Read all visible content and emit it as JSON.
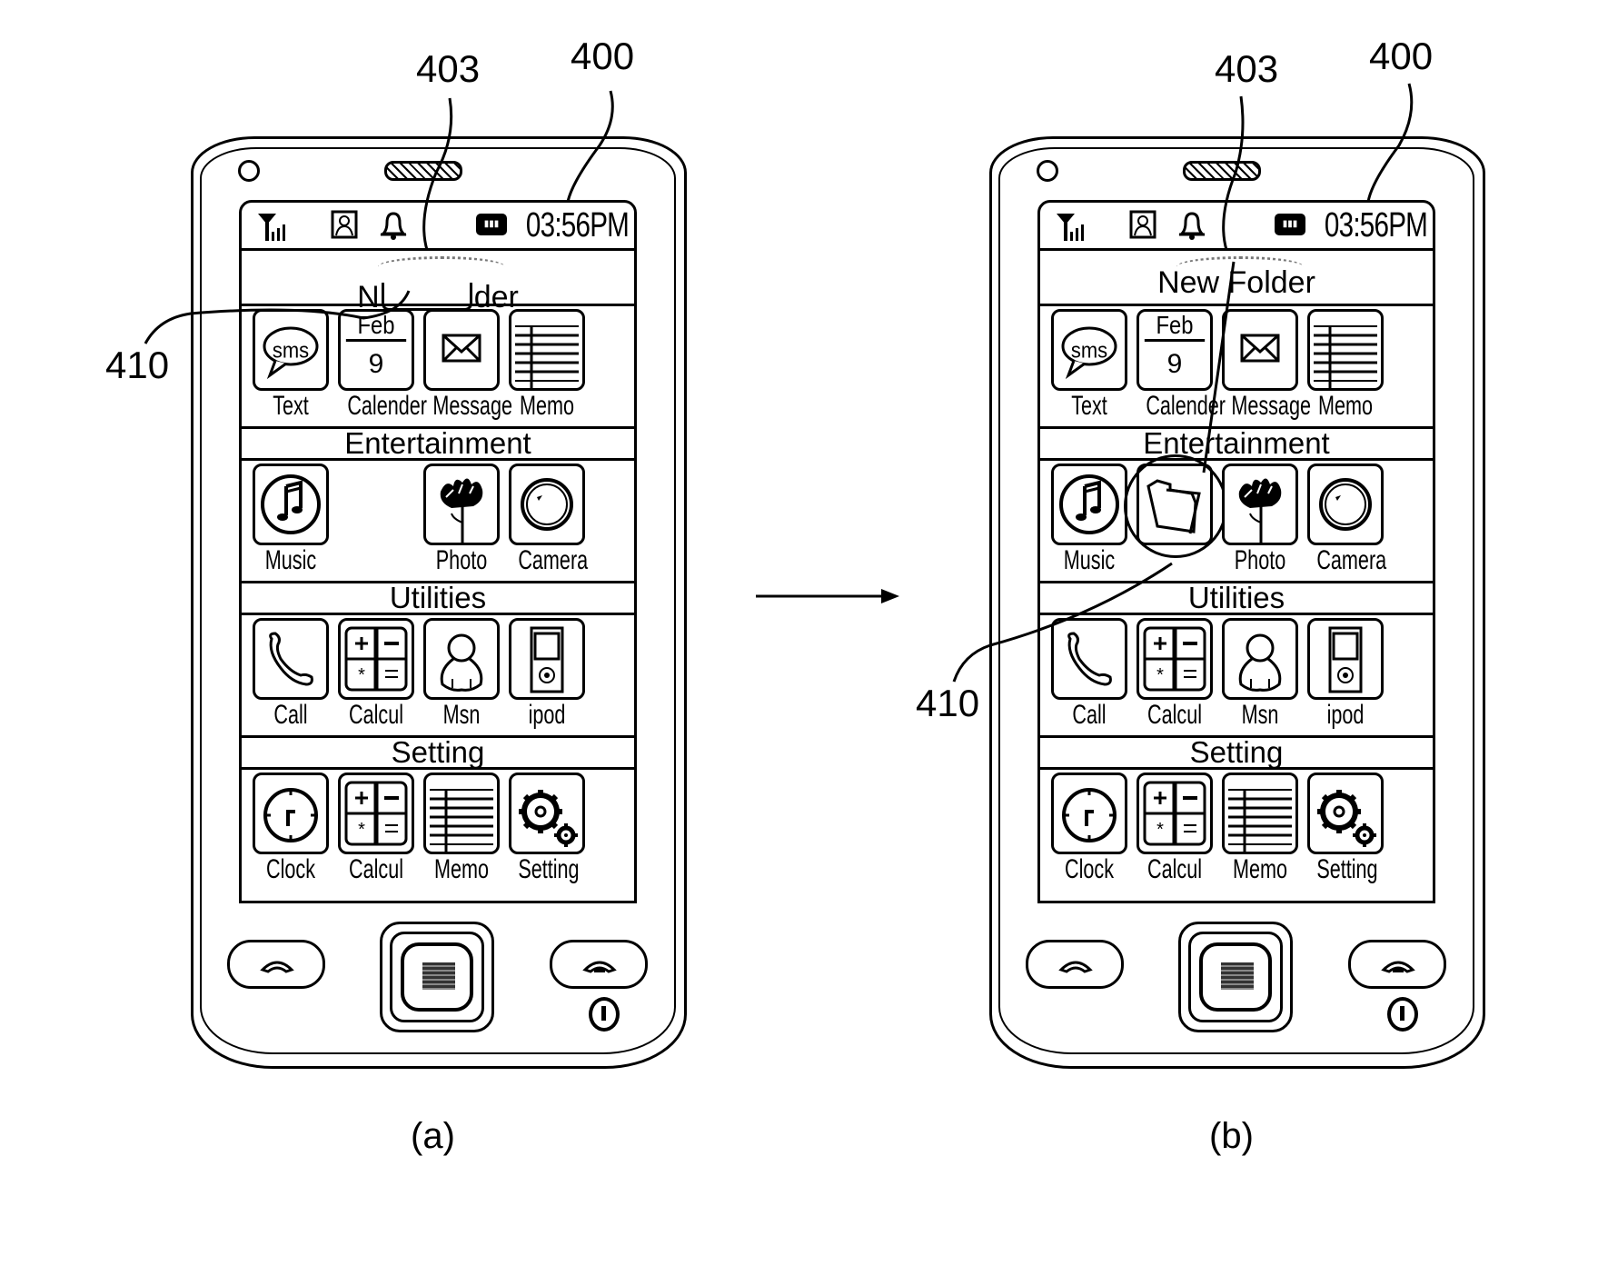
{
  "figure": {
    "arrow_direction": "right",
    "panels": [
      {
        "id": "a",
        "caption": "(a)",
        "refs": {
          "phone": "400",
          "folder_name_field": "403",
          "folder_icon": "410"
        },
        "status_bar": {
          "signal_icon": "signal-icon",
          "contact_icon": "contact-icon",
          "bell_icon": "bell-icon",
          "battery_icon": "battery-icon",
          "time": "03:56PM"
        },
        "title_bar": {
          "text_left": "N",
          "text_right": "der",
          "editing": true
        },
        "sections": [
          {
            "header": "",
            "apps": [
              {
                "label": "Text",
                "icon": "sms-icon"
              },
              {
                "label": "Calender",
                "icon": "calendar-icon",
                "month": "Feb",
                "day": "9"
              },
              {
                "label": "Message",
                "icon": "envelope-icon"
              },
              {
                "label": "Memo",
                "icon": "memo-icon"
              }
            ]
          },
          {
            "header": "Entertainment",
            "apps": [
              {
                "label": "Music",
                "icon": "music-icon"
              },
              {
                "label": "",
                "icon": "empty-slot"
              },
              {
                "label": "Photo",
                "icon": "flower-icon"
              },
              {
                "label": "Camera",
                "icon": "camera-icon"
              }
            ]
          },
          {
            "header": "Utilities",
            "apps": [
              {
                "label": "Call",
                "icon": "phone-icon"
              },
              {
                "label": "Calcul",
                "icon": "calculator-icon"
              },
              {
                "label": "Msn",
                "icon": "person-icon"
              },
              {
                "label": "ipod",
                "icon": "ipod-icon"
              }
            ]
          },
          {
            "header": "Setting",
            "apps": [
              {
                "label": "Clock",
                "icon": "clock-icon"
              },
              {
                "label": "Calcul",
                "icon": "calculator-icon"
              },
              {
                "label": "Memo",
                "icon": "memo-icon"
              },
              {
                "label": "Setting",
                "icon": "gear-icon"
              }
            ]
          }
        ]
      },
      {
        "id": "b",
        "caption": "(b)",
        "refs": {
          "phone": "400",
          "folder_name_field": "403",
          "folder_icon": "410"
        },
        "status_bar": {
          "time": "03:56PM"
        },
        "title_bar": {
          "text": "New Folder"
        },
        "sections": [
          {
            "header": "",
            "apps": [
              {
                "label": "Text",
                "icon": "sms-icon"
              },
              {
                "label": "Calender",
                "icon": "calendar-icon",
                "month": "Feb",
                "day": "9"
              },
              {
                "label": "Message",
                "icon": "envelope-icon"
              },
              {
                "label": "Memo",
                "icon": "memo-icon"
              }
            ]
          },
          {
            "header": "Entertainment",
            "apps": [
              {
                "label": "Music",
                "icon": "music-icon"
              },
              {
                "label": "",
                "icon": "folder-icon",
                "highlighted": true
              },
              {
                "label": "Photo",
                "icon": "flower-icon"
              },
              {
                "label": "Camera",
                "icon": "camera-icon"
              }
            ]
          },
          {
            "header": "Utilities",
            "apps": [
              {
                "label": "Call",
                "icon": "phone-icon"
              },
              {
                "label": "Calcul",
                "icon": "calculator-icon"
              },
              {
                "label": "Msn",
                "icon": "person-icon"
              },
              {
                "label": "ipod",
                "icon": "ipod-icon"
              }
            ]
          },
          {
            "header": "Setting",
            "apps": [
              {
                "label": "Clock",
                "icon": "clock-icon"
              },
              {
                "label": "Calcul",
                "icon": "calculator-icon"
              },
              {
                "label": "Memo",
                "icon": "memo-icon"
              },
              {
                "label": "Setting",
                "icon": "gear-icon"
              }
            ]
          }
        ]
      }
    ]
  }
}
